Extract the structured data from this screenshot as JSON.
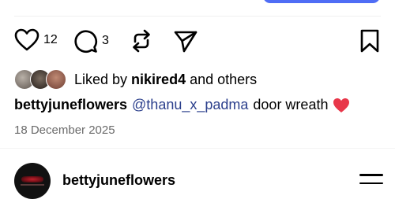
{
  "post": {
    "likes_count": "12",
    "comments_count": "3",
    "liked_by_prefix": "Liked by ",
    "liked_by_user": "nikired4",
    "liked_by_suffix": " and others",
    "caption_user": "bettyjuneflowers",
    "caption_mention": "@thanu_x_padma",
    "caption_text": "door wreath",
    "date": "18 December 2025"
  },
  "next_post": {
    "username": "bettyjuneflowers"
  },
  "icons": {
    "like": "heart-outline-icon",
    "comment": "comment-bubble-icon",
    "repost": "repost-icon",
    "share": "send-icon",
    "save": "bookmark-icon",
    "caption_emoji": "red-heart-emoji",
    "menu": "hamburger-menu-icon"
  },
  "colors": {
    "accent": "#4f6df5",
    "mention": "#2b3f8c",
    "heart": "#e8374a",
    "muted_text": "#6b6b6b"
  }
}
